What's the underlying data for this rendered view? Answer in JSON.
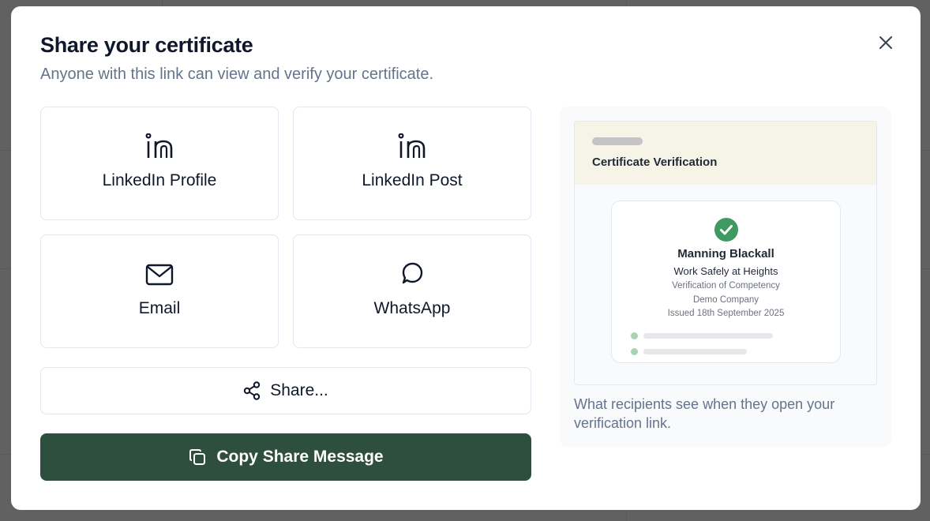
{
  "modal": {
    "title": "Share your certificate",
    "subtitle": "Anyone with this link can view and verify your certificate.",
    "close_icon": "close-icon"
  },
  "share_options": [
    {
      "label": "LinkedIn Profile",
      "icon": "linkedin-icon"
    },
    {
      "label": "LinkedIn Post",
      "icon": "linkedin-icon"
    },
    {
      "label": "Email",
      "icon": "mail-icon"
    },
    {
      "label": "WhatsApp",
      "icon": "chat-bubble-icon"
    }
  ],
  "share_button": {
    "label": "Share...",
    "icon": "share-icon"
  },
  "copy_button": {
    "label": "Copy Share Message",
    "icon": "copy-icon"
  },
  "preview": {
    "header_title": "Certificate Verification",
    "holder_name": "Manning Blackall",
    "course": "Work Safely at Heights",
    "type": "Verification of Competency",
    "company": "Demo Company",
    "issued": "Issued 18th September 2025",
    "caption": "What recipients see when they open your verification link.",
    "check_icon": "check-circle-icon"
  },
  "colors": {
    "primary": "#2f4f3e",
    "verified": "#3f9a62",
    "preview_header": "#f6f3e7",
    "muted_text": "#64748b"
  }
}
